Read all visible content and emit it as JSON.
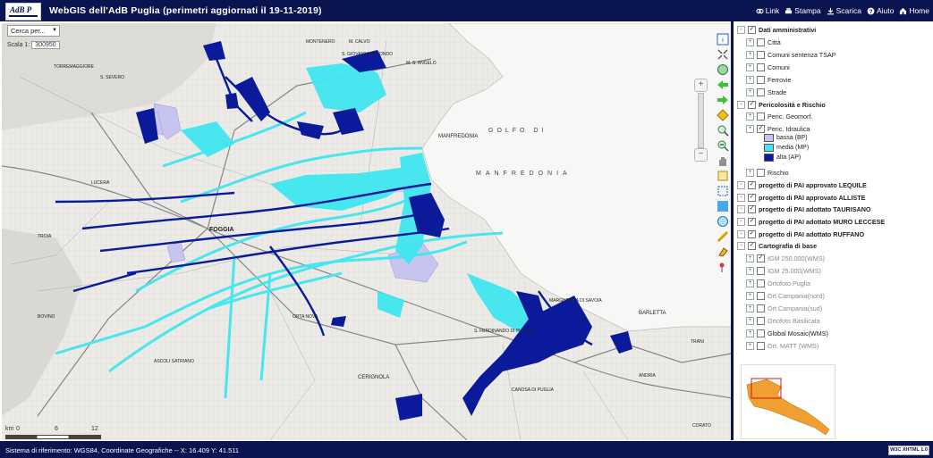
{
  "header": {
    "logo_text": "AdB P",
    "title": "WebGIS  dell'AdB Puglia  (perimetri aggiornati il 19-11-2019)",
    "menu": [
      {
        "label": "Link",
        "icon": "link-icon"
      },
      {
        "label": "Stampa",
        "icon": "print-icon"
      },
      {
        "label": "Scarica",
        "icon": "download-icon"
      },
      {
        "label": "Aiuto",
        "icon": "help-icon"
      },
      {
        "label": "Home",
        "icon": "home-icon"
      }
    ]
  },
  "map": {
    "search_placeholder": "Cerca per...",
    "scale_label": "Scala 1:",
    "scale_value": "300950",
    "scalebar": {
      "unit": "km",
      "ticks": [
        "0",
        "6",
        "12"
      ]
    },
    "place_labels": [
      "S. SEVERO",
      "TORREMAGGIORE",
      "MANFREDONIA",
      "GOLFO DI",
      "MANFREDONIA",
      "FOGGIA",
      "ORTA NOVA",
      "CERIGNOLA",
      "S. FERDINANDO DI PUGLIA",
      "MARGHERITA DI SAVOIA",
      "BARLETTA",
      "TRANI",
      "ANDRIA",
      "CANOSA DI PUGLIA",
      "CORATO",
      "MONTENERO",
      "M. CALVO",
      "S. GIOVANNI ROTONDO",
      "M. S. ANGELO",
      "LUCERA",
      "TROIA",
      "BOVINO",
      "ASCOLI SATRIANO"
    ],
    "colors": {
      "bassa": "#c8c4f0",
      "media": "#40e6f0",
      "alta": "#0a1a9a",
      "sea": "#f7f7f5"
    }
  },
  "toolbar": {
    "tools": [
      "info-icon",
      "zoom-extent-icon",
      "back-arrow-icon",
      "forward-arrow-icon",
      "layer-icon",
      "zoom-in-icon",
      "zoom-out-icon",
      "pan-hand-icon",
      "select-icon",
      "zoom-box-icon",
      "refresh-icon",
      "globe-icon",
      "measure-icon",
      "clear-icon",
      "pin-icon"
    ]
  },
  "panel": {
    "tree": [
      {
        "label": "Dati amministrativi",
        "bold": true,
        "checked": true,
        "level": 0
      },
      {
        "label": "Città",
        "checked": false,
        "level": 1
      },
      {
        "label": "Comuni sentenza TSAP",
        "checked": false,
        "level": 1
      },
      {
        "label": "Comuni",
        "checked": false,
        "level": 1
      },
      {
        "label": "Ferrovie",
        "checked": false,
        "level": 1
      },
      {
        "label": "Strade",
        "checked": false,
        "level": 1
      },
      {
        "label": "Pericolosità e Rischio",
        "bold": true,
        "checked": true,
        "level": 0
      },
      {
        "label": "Peric. Geomorf.",
        "checked": false,
        "level": 1
      },
      {
        "label": "Peric. Idraulica",
        "checked": true,
        "level": 1
      },
      {
        "label": "Rischio",
        "checked": false,
        "level": 1
      },
      {
        "label": "progetto di PAI approvato LEQUILE",
        "bold": true,
        "checked": true,
        "level": 0
      },
      {
        "label": "progetto di PAI approvato ALLISTE",
        "bold": true,
        "checked": true,
        "level": 0
      },
      {
        "label": "progetto di PAI adottato TAURISANO",
        "bold": true,
        "checked": true,
        "level": 0
      },
      {
        "label": "progetto di PAI adottato MURO LECCESE",
        "bold": true,
        "checked": true,
        "level": 0
      },
      {
        "label": "progetto di PAI adottato RUFFANO",
        "bold": true,
        "checked": true,
        "level": 0
      },
      {
        "label": "Cartografia di base",
        "bold": true,
        "checked": true,
        "level": 0
      },
      {
        "label": "IGM 250.000(WMS)",
        "checked": true,
        "gray": true,
        "level": 1
      },
      {
        "label": "IGM 25.000(WMS)",
        "checked": false,
        "gray": true,
        "level": 1
      },
      {
        "label": "Ortofoto Puglia",
        "checked": false,
        "gray": true,
        "level": 1
      },
      {
        "label": "Ort.Campania(nord)",
        "checked": false,
        "gray": true,
        "level": 1
      },
      {
        "label": "Ort.Campania(sud)",
        "checked": false,
        "gray": true,
        "level": 1
      },
      {
        "label": "Ortofoto Basilicata",
        "checked": false,
        "gray": true,
        "level": 1
      },
      {
        "label": "Global Mosaic(WMS)",
        "checked": false,
        "level": 1
      },
      {
        "label": "Ort. MATT (WMS)",
        "checked": false,
        "gray": true,
        "level": 1
      }
    ],
    "legend": [
      {
        "label": "bassa (BP)",
        "color": "#c8c4f0"
      },
      {
        "label": "media (MP)",
        "color": "#40e6f0"
      },
      {
        "label": "alta (AP)",
        "color": "#0a1a9a"
      }
    ]
  },
  "footer": {
    "srs_text": "Sistema di riferimento: WGS84, Coordinate Geografiche -- X: 16.409    Y: 41.511",
    "badge": "W3C XHTML 1.0"
  }
}
